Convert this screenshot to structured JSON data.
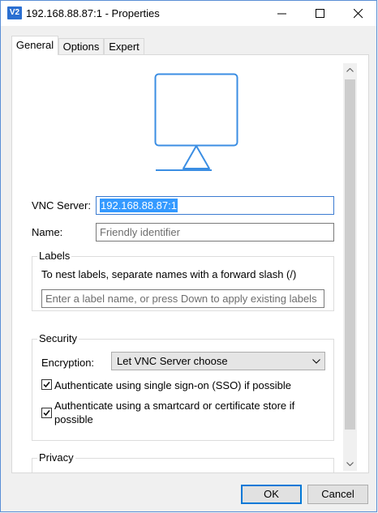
{
  "window": {
    "title": "192.168.88.87:1 - Properties",
    "app_icon_text": "V2"
  },
  "tabs": [
    {
      "label": "General",
      "active": true
    },
    {
      "label": "Options",
      "active": false
    },
    {
      "label": "Expert",
      "active": false
    }
  ],
  "general": {
    "vnc_server_label": "VNC Server:",
    "vnc_server_value": "192.168.88.87:1",
    "name_label": "Name:",
    "name_placeholder": "Friendly identifier"
  },
  "labels_group": {
    "title": "Labels",
    "hint": "To nest labels, separate names with a forward slash (/)",
    "input_placeholder": "Enter a label name, or press Down to apply existing labels"
  },
  "security_group": {
    "title": "Security",
    "encryption_label": "Encryption:",
    "encryption_value": "Let VNC Server choose",
    "sso_label": "Authenticate using single sign-on (SSO) if possible",
    "sso_checked": true,
    "smartcard_label": "Authenticate using a smartcard or certificate store if possible",
    "smartcard_checked": true
  },
  "privacy_group": {
    "title": "Privacy"
  },
  "footer": {
    "ok_label": "OK",
    "cancel_label": "Cancel"
  },
  "colors": {
    "accent": "#3b8ee3",
    "selection": "#3399ff",
    "focus_border": "#0078d7"
  },
  "icons": {
    "monitor": "monitor-icon",
    "minimize": "minimize-icon",
    "maximize": "maximize-icon",
    "close": "close-icon"
  }
}
